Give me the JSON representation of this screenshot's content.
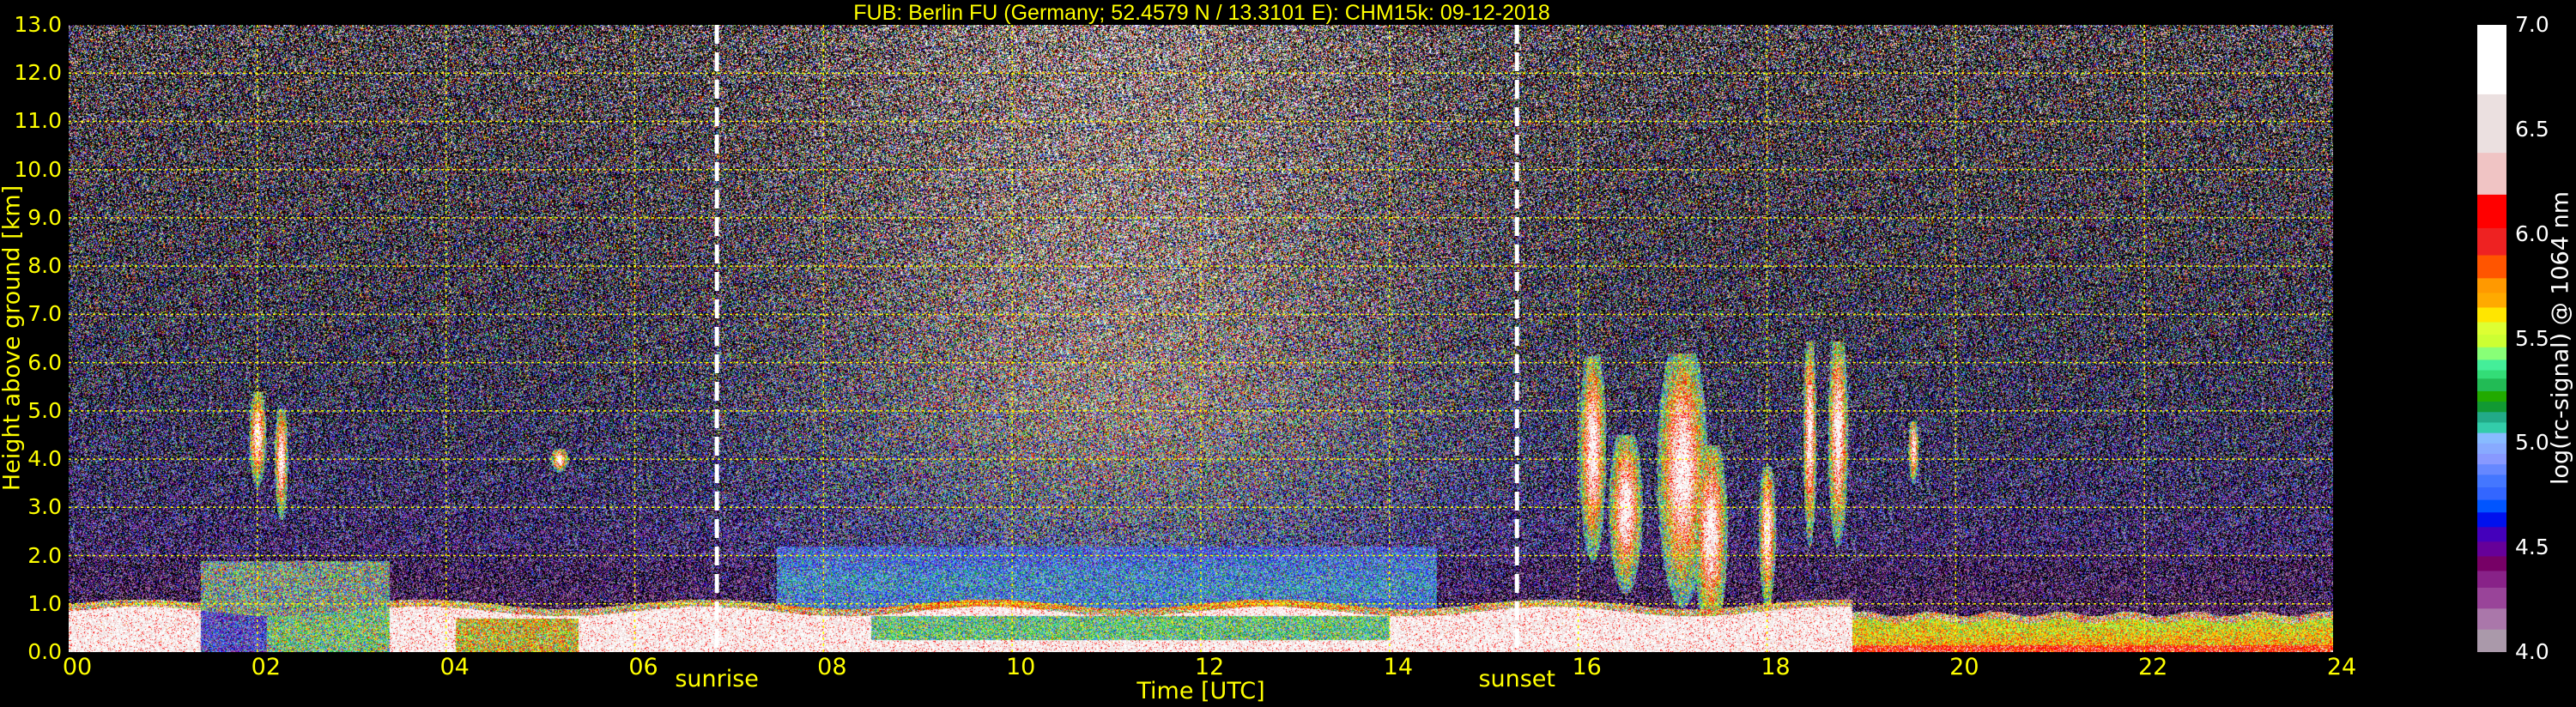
{
  "chart_data": {
    "type": "heatmap",
    "title": "FUB: Berlin FU (Germany; 52.4579 N / 13.3101 E):    CHM15k: 09-12-2018",
    "xlabel": "Time [UTC]",
    "ylabel": "Height above ground [km]",
    "xlim": [
      0,
      24
    ],
    "ylim": [
      0,
      13
    ],
    "x_ticks": [
      "00",
      "02",
      "04",
      "06",
      "08",
      "10",
      "12",
      "14",
      "16",
      "18",
      "20",
      "22",
      "24"
    ],
    "y_ticks": [
      "0.0",
      "1.0",
      "2.0",
      "3.0",
      "4.0",
      "5.0",
      "6.0",
      "7.0",
      "8.0",
      "9.0",
      "10.0",
      "11.0",
      "12.0",
      "13.0"
    ],
    "grid": true,
    "grid_color": "#ffff00",
    "background": "#000000",
    "markers": [
      {
        "label": "sunrise",
        "time": 6.87
      },
      {
        "label": "sunset",
        "time": 15.35
      }
    ],
    "colorbar": {
      "label": "log(rc-signal) @ 1064 nm",
      "range": [
        4.0,
        7.0
      ],
      "ticks": [
        "4.0",
        "4.5",
        "5.0",
        "5.5",
        "6.0",
        "6.5",
        "7.0"
      ],
      "bounds": [
        4.0,
        4.11,
        4.21,
        4.31,
        4.39,
        4.46,
        4.53,
        4.6,
        4.67,
        4.73,
        4.79,
        4.85,
        4.9,
        4.95,
        5.0,
        5.05,
        5.1,
        5.15,
        5.2,
        5.25,
        5.31,
        5.35,
        5.4,
        5.46,
        5.52,
        5.58,
        5.65,
        5.72,
        5.79,
        5.9,
        6.03,
        6.19,
        6.39,
        6.67,
        7.0
      ],
      "colors": [
        "#aa99aa",
        "#aa77aa",
        "#994499",
        "#882288",
        "#770066",
        "#660099",
        "#4400bb",
        "#0011ee",
        "#0055ff",
        "#3366ff",
        "#4477ff",
        "#6688ff",
        "#8899ff",
        "#88aaff",
        "#88bbff",
        "#33ccaa",
        "#22aa88",
        "#119933",
        "#22aa00",
        "#22bb55",
        "#33dd77",
        "#44ee99",
        "#88ff77",
        "#ccff33",
        "#ddff33",
        "#ffe600",
        "#ffaa00",
        "#ff9900",
        "#ff5500",
        "#ee2222",
        "#ff0000",
        "#f0c4c4",
        "#ebe0e0",
        "#ffffff"
      ]
    },
    "features": [
      {
        "description_label": "boundary layer",
        "time": [
          0,
          24
        ],
        "top_km": 1.0
      },
      {
        "time": [
          1.4,
          3.4
        ],
        "height_km": [
          0.0,
          1.9
        ]
      },
      {
        "time": [
          16.1,
          19.0
        ],
        "height_km": [
          0.0,
          5.8
        ]
      },
      {
        "time": [
          19.0,
          24.0
        ],
        "height_km": [
          0.0,
          0.7
        ]
      }
    ]
  }
}
